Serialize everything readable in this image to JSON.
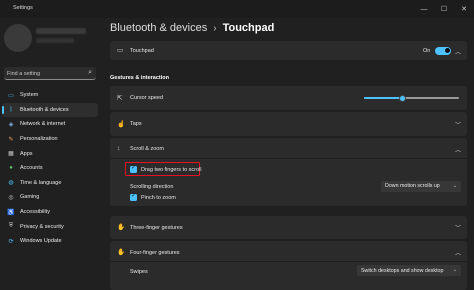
{
  "window": {
    "title": "Settings",
    "minimize": "—",
    "maximize": "☐",
    "close": "✕"
  },
  "search": {
    "placeholder": "Find a setting"
  },
  "sidebar": {
    "items": [
      {
        "label": "System",
        "icon": "system-icon",
        "color": "#4cc2ff",
        "glyph": "▭"
      },
      {
        "label": "Bluetooth & devices",
        "icon": "bluetooth-icon",
        "color": "#4cc2ff",
        "glyph": "ᛒ",
        "active": true
      },
      {
        "label": "Network & internet",
        "icon": "network-icon",
        "color": "#7fb6e8",
        "glyph": "◈"
      },
      {
        "label": "Personalization",
        "icon": "brush-icon",
        "color": "#e8a36b",
        "glyph": "✎"
      },
      {
        "label": "Apps",
        "icon": "apps-icon",
        "color": "#c9c9c9",
        "glyph": "▦"
      },
      {
        "label": "Accounts",
        "icon": "accounts-icon",
        "color": "#5fc46f",
        "glyph": "●"
      },
      {
        "label": "Time & language",
        "icon": "globe-icon",
        "color": "#4cc2ff",
        "glyph": "◍"
      },
      {
        "label": "Gaming",
        "icon": "gaming-icon",
        "color": "#c9c9c9",
        "glyph": "◎"
      },
      {
        "label": "Accessibility",
        "icon": "accessibility-icon",
        "color": "#4cc2ff",
        "glyph": "♿"
      },
      {
        "label": "Privacy & security",
        "icon": "shield-icon",
        "color": "#c9c9c9",
        "glyph": "⛨"
      },
      {
        "label": "Windows Update",
        "icon": "update-icon",
        "color": "#4cc2ff",
        "glyph": "⟳"
      }
    ]
  },
  "breadcrumb": {
    "parent": "Bluetooth & devices",
    "separator": "›",
    "current": "Touchpad"
  },
  "touchpad": {
    "label": "Touchpad",
    "state": "On",
    "enabled": true,
    "icon": "touchpad-icon"
  },
  "gestures": {
    "title": "Gestures & interaction",
    "cursor_speed": {
      "label": "Cursor speed",
      "value": 0.4
    },
    "taps": {
      "label": "Taps"
    },
    "scroll_zoom": {
      "label": "Scroll & zoom",
      "drag_scroll": {
        "label": "Drag two fingers to scroll",
        "checked": true
      },
      "scrolling_direction": {
        "label": "Scrolling direction",
        "value": "Down motion scrolls up"
      },
      "pinch_zoom": {
        "label": "Pinch to zoom",
        "checked": true
      }
    },
    "three_finger": {
      "label": "Three-finger gestures"
    },
    "four_finger": {
      "label": "Four-finger gestures",
      "swipes": {
        "label": "Swipes",
        "value": "Switch desktops and show desktop"
      }
    }
  }
}
